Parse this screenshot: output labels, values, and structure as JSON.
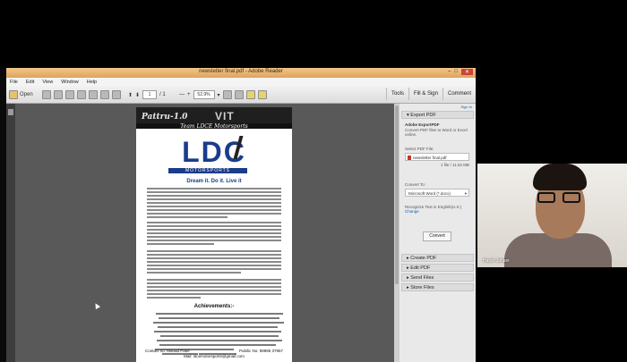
{
  "app": {
    "window_title": "newsletter final.pdf - Adobe Reader",
    "menu": [
      "File",
      "Edit",
      "View",
      "Window",
      "Help"
    ],
    "toolbar": {
      "open_label": "Open",
      "page_current": "1",
      "page_total": "/ 1",
      "zoom": "52.9%",
      "tools_label": "Tools",
      "fill_sign_label": "Fill & Sign",
      "comment_label": "Comment"
    }
  },
  "document": {
    "banner_brand": "Pattru-1.0",
    "banner_logo": "VIT",
    "team_line": "Team LDCE Motorsports",
    "logo_text": "LDC",
    "logo_sub": "MOTORSPORTS",
    "tagline": "Dream it. Do it. Live it",
    "achievements_heading": "Achievements:-",
    "contact_left": "Contact no: Manad Patel",
    "contact_right": "Pubilic No: 98985 37957",
    "email": "Mail: ldcemotorsports@gmail.com"
  },
  "panel": {
    "sign_in": "Sign In",
    "export_heading": "Export PDF",
    "export_app": "Adobe ExportPDF",
    "export_desc": "Convert PDF files to Word or Excel online.",
    "select_label": "Select PDF File:",
    "file_name": "newsletter final.pdf",
    "file_count": "1 file / 11.52 MB",
    "convert_to_label": "Convert To:",
    "convert_to_value": "Microsoft Word (*.docx)",
    "recognize_text": "Recognize Text in English(U.S.)",
    "change_label": "Change",
    "convert_button": "Convert",
    "create_pdf": "Create PDF",
    "edit_pdf": "Edit PDF",
    "send_files": "Send Files",
    "store_files": "Store Files"
  },
  "video": {
    "participant_name": "Harsh Jahani"
  },
  "colors": {
    "title_bar": "#e0a35c",
    "logo_blue": "#1a3c8a",
    "doc_bg": "#595959"
  }
}
